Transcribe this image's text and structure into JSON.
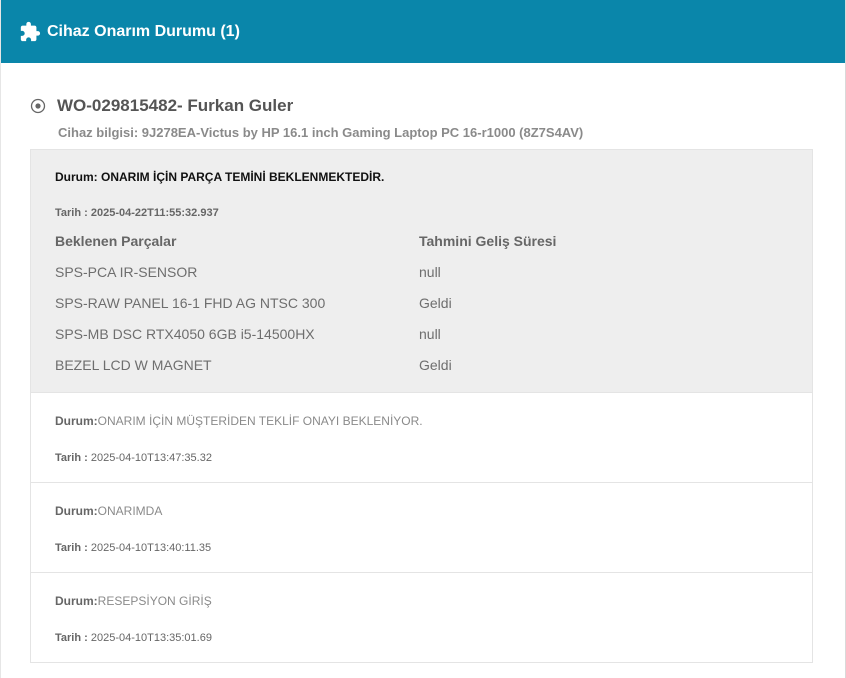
{
  "header": {
    "title": "Cihaz Onarım Durumu (1)",
    "icon": "puzzle-icon",
    "bg_color": "#0a86aa"
  },
  "work_order": {
    "title": "WO-029815482- Furkan Guler",
    "device_info": "Cihaz bilgisi: 9J278EA-Victus by HP 16.1 inch Gaming Laptop PC 16-r1000 (8Z7S4AV)"
  },
  "statuses": [
    {
      "label": "Durum:",
      "value": "ONARIM İÇİN PARÇA TEMİNİ BEKLENMEKTEDİR.",
      "date_label": "Tarih :",
      "date": "2025-04-22T11:55:32.937",
      "parts_headers": [
        "Beklenen Parçalar",
        "Tahmini Geliş Süresi"
      ],
      "parts": [
        {
          "name": "SPS-PCA IR-SENSOR",
          "eta": "null"
        },
        {
          "name": "SPS-RAW PANEL 16-1 FHD AG NTSC 300",
          "eta": "Geldi"
        },
        {
          "name": "SPS-MB DSC RTX4050 6GB i5-14500HX",
          "eta": "null"
        },
        {
          "name": "BEZEL LCD W MAGNET",
          "eta": "Geldi"
        }
      ]
    },
    {
      "label": "Durum:",
      "value": "ONARIM İÇİN MÜŞTERİDEN TEKLİF ONAYI BEKLENİYOR.",
      "date_label": "Tarih :",
      "date": "2025-04-10T13:47:35.32"
    },
    {
      "label": "Durum:",
      "value": "ONARIMDA",
      "date_label": "Tarih :",
      "date": "2025-04-10T13:40:11.35"
    },
    {
      "label": "Durum:",
      "value": "RESEPSİYON GİRİŞ",
      "date_label": "Tarih :",
      "date": "2025-04-10T13:35:01.69"
    }
  ]
}
